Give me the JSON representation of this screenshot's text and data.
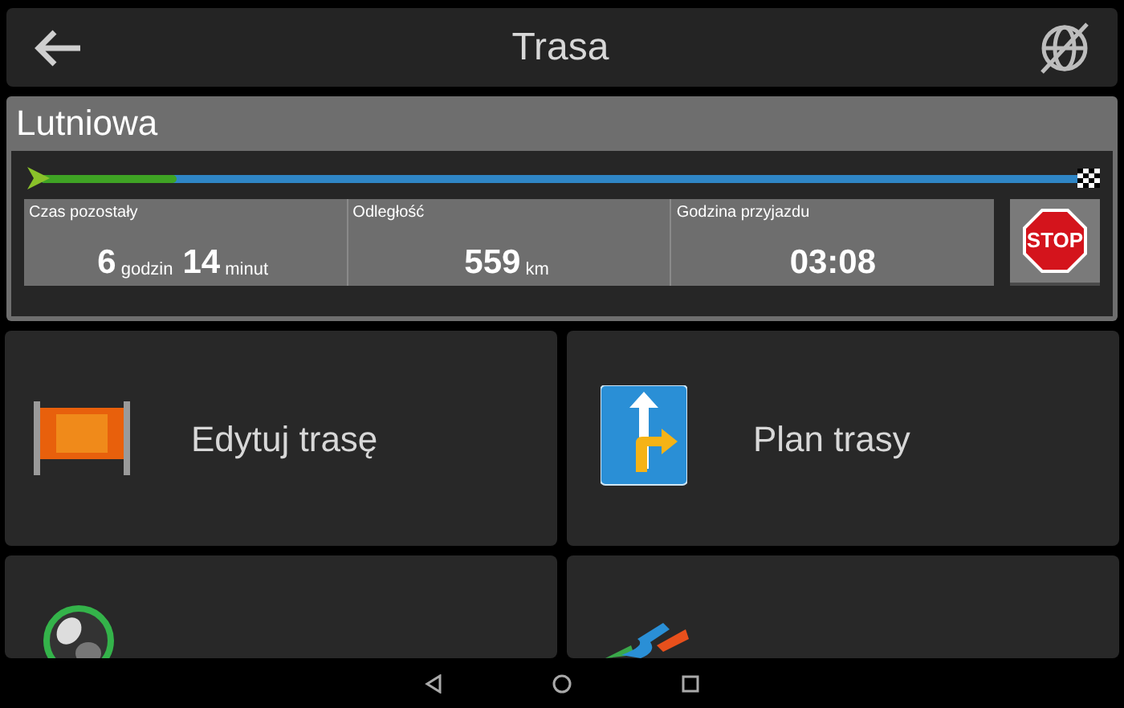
{
  "header": {
    "title": "Trasa"
  },
  "route": {
    "name": "Lutniowa",
    "progress": {
      "level": 0.13
    },
    "stats": [
      {
        "label": "Czas pozostały",
        "parts": [
          {
            "value": "6",
            "unit": "godzin"
          },
          {
            "value": "14",
            "unit": "minut"
          }
        ]
      },
      {
        "label": "Odległość",
        "parts": [
          {
            "value": "559",
            "unit": "km"
          }
        ]
      },
      {
        "label": "Godzina przyjazdu",
        "parts": [
          {
            "value": "03:08"
          }
        ]
      }
    ],
    "stop_button": "STOP"
  },
  "tiles": [
    {
      "kind": "barrier",
      "label": "Edytuj trasę"
    },
    {
      "kind": "plan",
      "label": "Plan trasy"
    },
    {
      "kind": "show"
    },
    {
      "kind": "avoid"
    }
  ]
}
